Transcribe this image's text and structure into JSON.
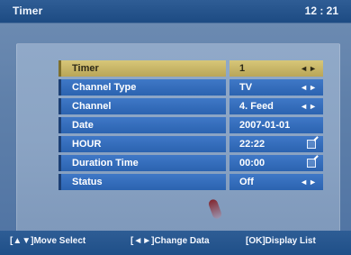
{
  "header": {
    "title": "Timer",
    "clock": "12 : 21"
  },
  "rows": [
    {
      "label": "Timer",
      "value": "1",
      "control": "arrows",
      "arrow_text": "◄►"
    },
    {
      "label": "Channel Type",
      "value": "TV",
      "control": "arrows",
      "arrow_text": "◄►"
    },
    {
      "label": "Channel",
      "value": "4. Feed",
      "control": "arrows",
      "arrow_text": "◄►"
    },
    {
      "label": "Date",
      "value": "2007-01-01",
      "control": "none",
      "arrow_text": ""
    },
    {
      "label": "HOUR",
      "value": "22:22",
      "control": "edit",
      "arrow_text": ""
    },
    {
      "label": "Duration Time",
      "value": "00:00",
      "control": "edit",
      "arrow_text": ""
    },
    {
      "label": "Status",
      "value": "Off",
      "control": "arrows",
      "arrow_text": "◄►"
    }
  ],
  "footer": {
    "move_select": "[▲▼]Move Select",
    "change_data": "[◄►]Change Data",
    "display_list": "[OK]Display List"
  },
  "colors": {
    "header_bg": "#1c4a82",
    "row_bg": "#2b63b0",
    "selected_bg": "#b9a557",
    "screen_bg": "#5f80aa"
  }
}
